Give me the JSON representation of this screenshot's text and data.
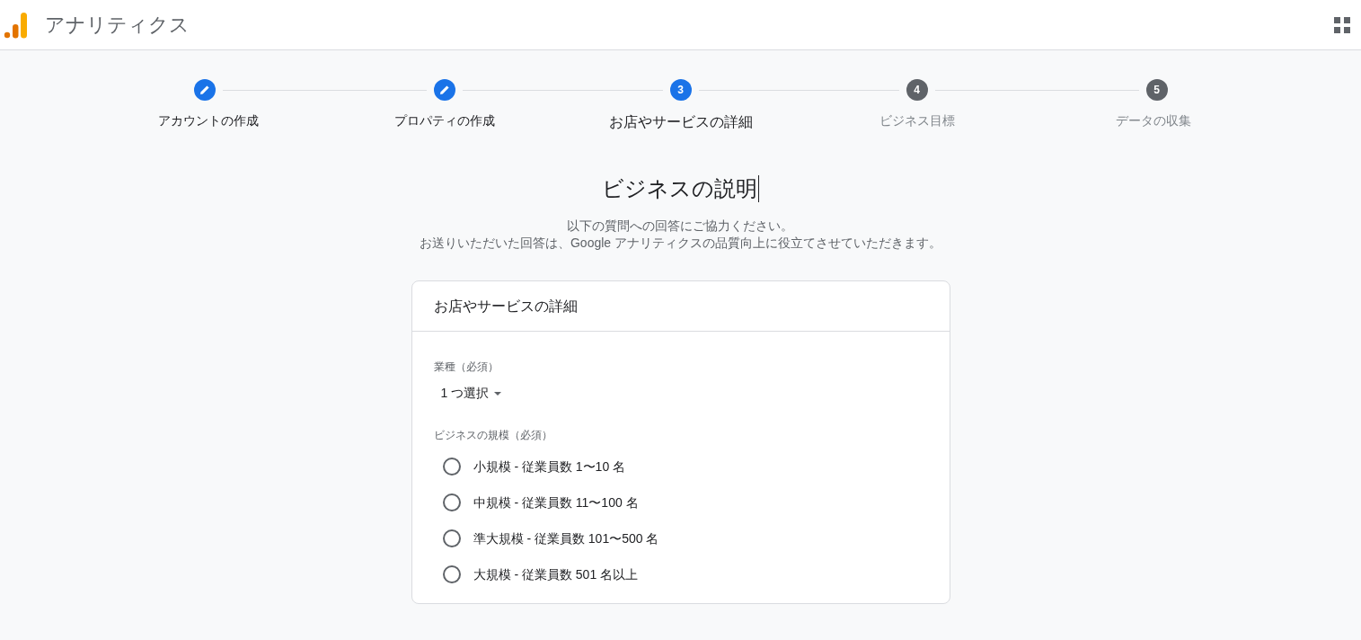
{
  "app_bar": {
    "title": "アナリティクス"
  },
  "steps": [
    {
      "label": "アカウントの作成",
      "kind": "done"
    },
    {
      "label": "プロパティの作成",
      "kind": "done"
    },
    {
      "label": "お店やサービスの詳細",
      "number": "3",
      "kind": "current"
    },
    {
      "label": "ビジネス目標",
      "number": "4",
      "kind": "upcoming"
    },
    {
      "label": "データの収集",
      "number": "5",
      "kind": "upcoming"
    }
  ],
  "heading": "ビジネスの説明",
  "intro": [
    "以下の質問への回答にご協力ください。",
    "お送りいただいた回答は、Google アナリティクスの品質向上に役立てさせていただきます。"
  ],
  "card": {
    "title": "お店やサービスの詳細",
    "industry": {
      "label": "業種（必須）",
      "value": "1 つ選択"
    },
    "size": {
      "label": "ビジネスの規模（必須）",
      "options": [
        {
          "label": "小規模 - 従業員数 1〜10 名",
          "selected": false
        },
        {
          "label": "中規模 - 従業員数 11〜100 名",
          "selected": false
        },
        {
          "label": "準大規模 - 従業員数 101〜500 名",
          "selected": false
        },
        {
          "label": "大規模 - 従業員数 501 名以上",
          "selected": false
        }
      ]
    }
  }
}
